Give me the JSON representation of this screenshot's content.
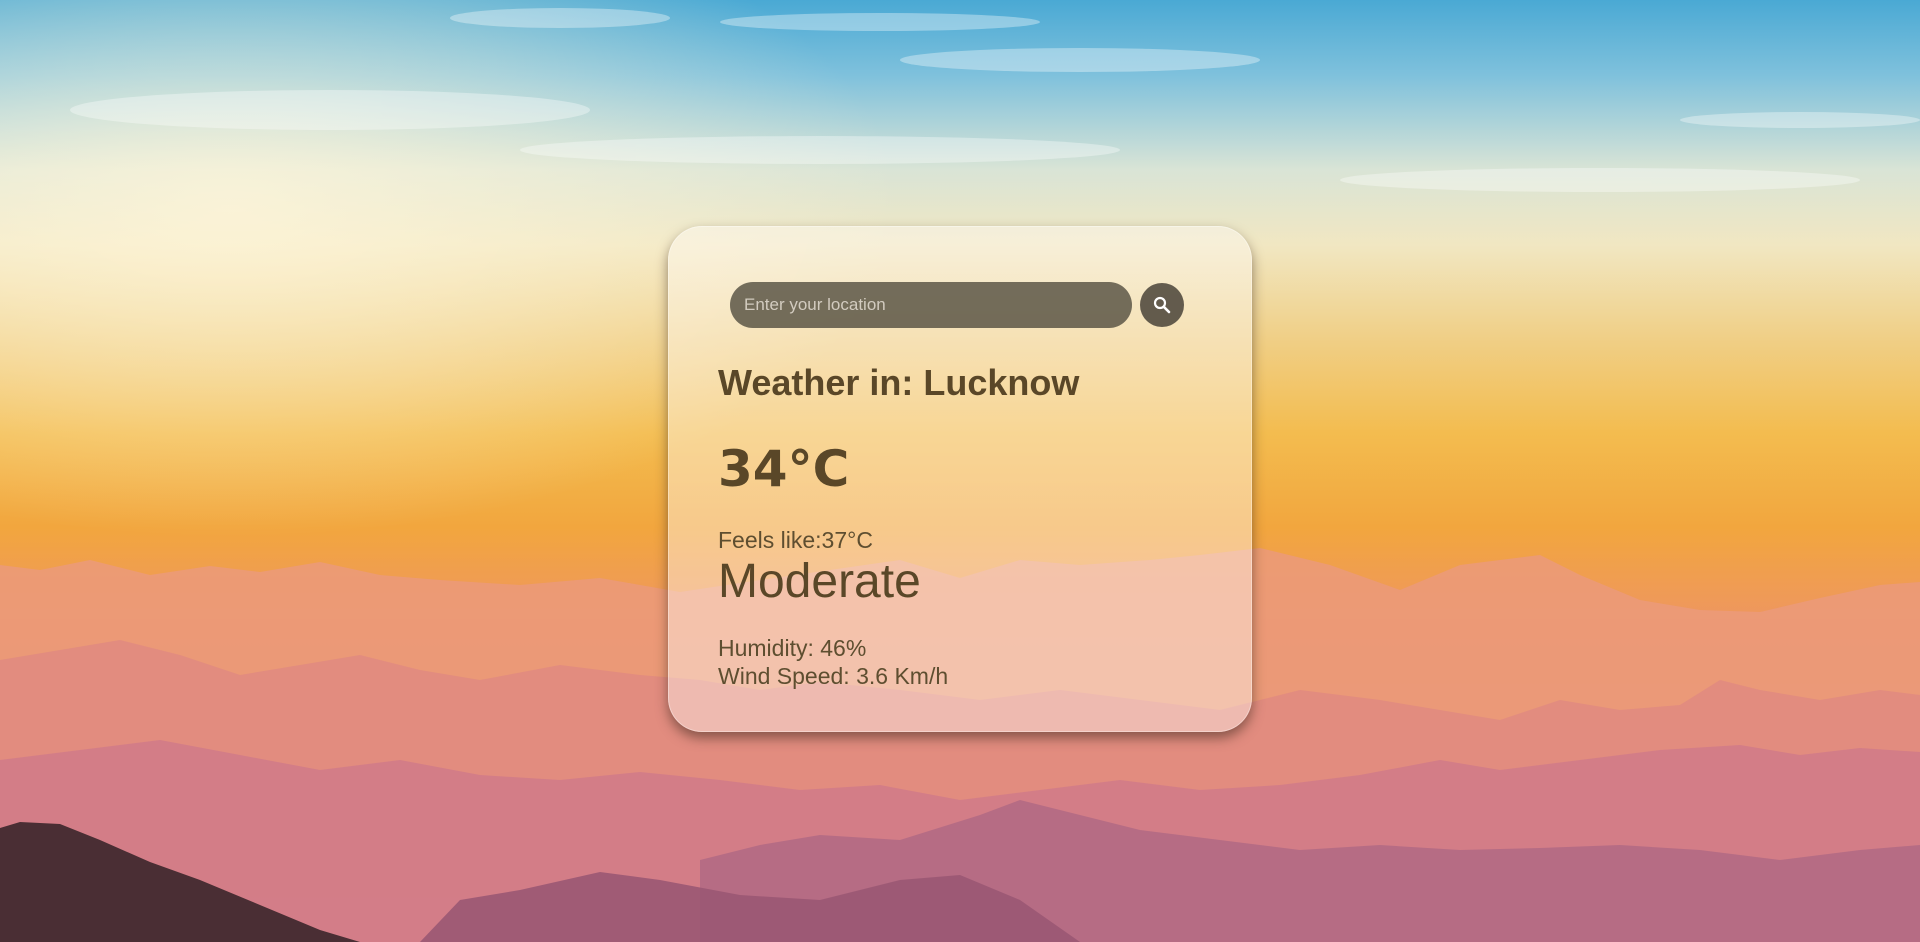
{
  "search": {
    "placeholder": "Enter your location",
    "value": "",
    "button_icon": "search-icon"
  },
  "weather": {
    "title": "Weather in: Lucknow",
    "temperature": "34°C",
    "feels_like": "Feels like:37°C",
    "description": "Moderate",
    "humidity": "Humidity: 46%",
    "wind_speed": "Wind Speed: 3.6 Km/h"
  },
  "colors": {
    "text": "#5a4728",
    "input_bg": "#565042",
    "sky_top": "#4fb0d6",
    "horizon": "#f2b53c",
    "mountains": "#c97a8a"
  }
}
